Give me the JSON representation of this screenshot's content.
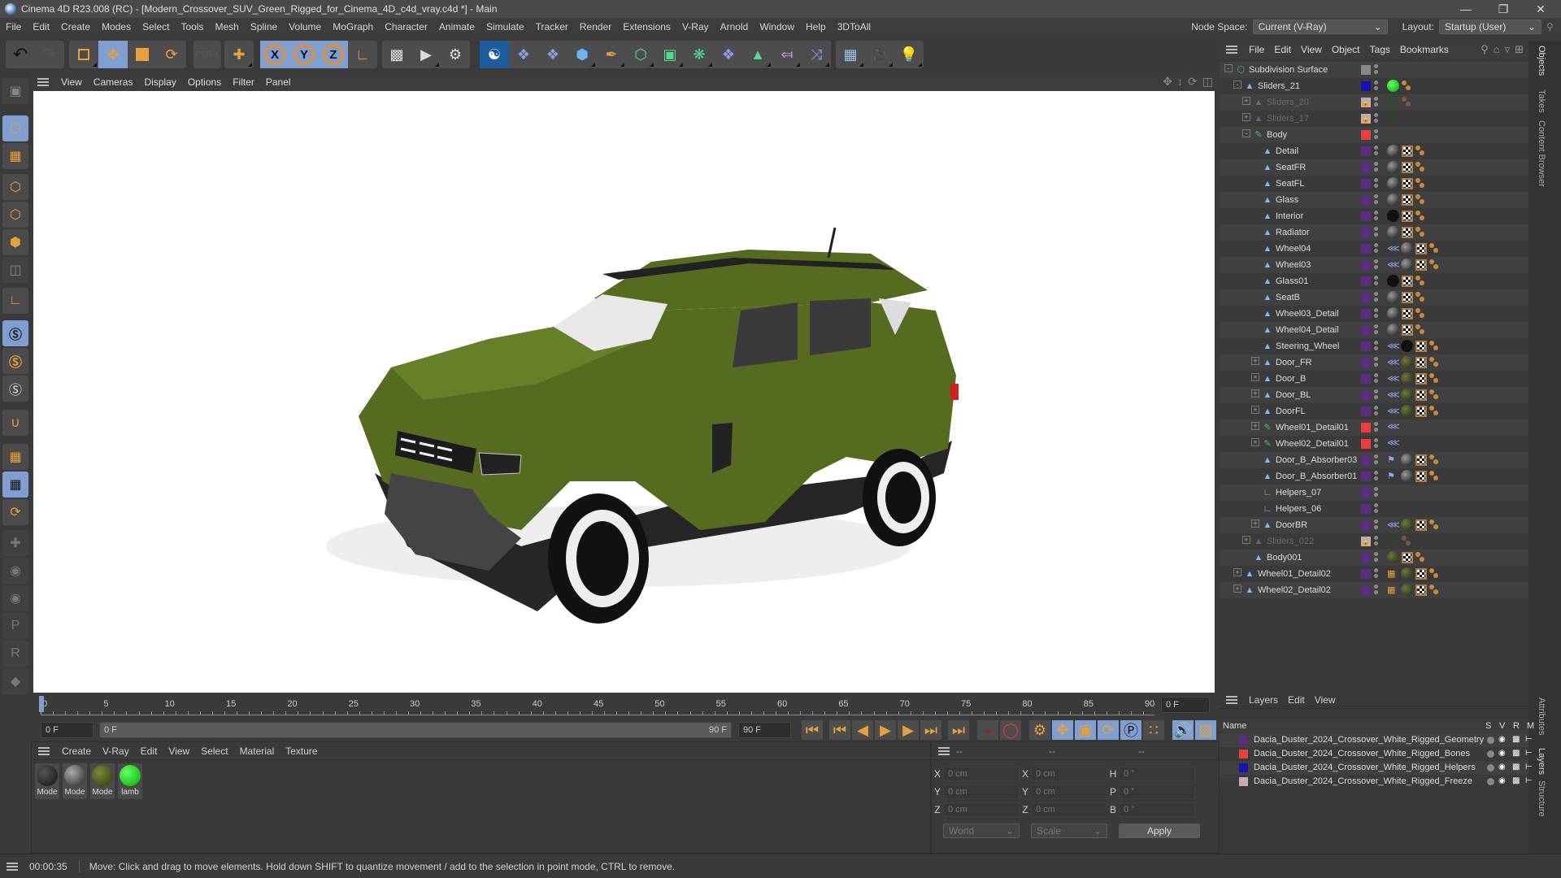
{
  "title": "Cinema 4D R23.008 (RC) - [Modern_Crossover_SUV_Green_Rigged_for_Cinema_4D_c4d_vray.c4d *] - Main",
  "window_controls": [
    "minimize",
    "restore",
    "close"
  ],
  "menu": [
    "File",
    "Edit",
    "Create",
    "Modes",
    "Select",
    "Tools",
    "Mesh",
    "Spline",
    "Volume",
    "MoGraph",
    "Character",
    "Animate",
    "Simulate",
    "Tracker",
    "Render",
    "Extensions",
    "V-Ray",
    "Arnold",
    "Window",
    "Help",
    "3DToAll"
  ],
  "node_space": {
    "label": "Node Space:",
    "value": "Current (V-Ray)"
  },
  "layout": {
    "label": "Layout:",
    "value": "Startup (User)"
  },
  "toolbar": {
    "axis_labels": [
      "X",
      "Y",
      "Z"
    ],
    "tools": [
      "undo",
      "redo",
      "live-selection",
      "move",
      "scale",
      "rotate",
      "psr-reset",
      "add-tool",
      "x-axis",
      "y-axis",
      "z-axis",
      "coordinate-system",
      "render-view",
      "render-picture-viewer",
      "render-settings",
      "vray-logo",
      "python-script-1",
      "python-script-2",
      "cube",
      "pen",
      "subdivision",
      "extrude",
      "boole",
      "python-script-3",
      "mograph-cloner",
      "symmetry",
      "deformer",
      "floor",
      "camera",
      "light"
    ]
  },
  "viewport_menu": [
    "View",
    "Cameras",
    "Display",
    "Options",
    "Filter",
    "Panel"
  ],
  "left_tools": [
    "make-editable",
    "model-mode",
    "texture-mode",
    "point-mode",
    "edge-mode",
    "polygon-mode",
    "uv-mode",
    "axis-mode",
    "snap",
    "snap-settings",
    "workplane-snap",
    "magnet",
    "workplane",
    "locked-workplane",
    "workplane-rotate",
    "joint-tool",
    "bind",
    "weight-tool",
    "pose-p",
    "pose-r",
    "pose-morph"
  ],
  "timeline": {
    "ticks": [
      "0",
      "5",
      "10",
      "15",
      "20",
      "25",
      "30",
      "35",
      "40",
      "45",
      "50",
      "55",
      "60",
      "65",
      "70",
      "75",
      "80",
      "85",
      "90"
    ],
    "current_frame_field": "0 F",
    "start_field": "0 F",
    "range_start": "0 F",
    "range_end": "90 F",
    "end_field": "90 F",
    "frame_readout": "0 F",
    "playhead_frame": 0
  },
  "materials": {
    "menu": [
      "Create",
      "V-Ray",
      "Edit",
      "View",
      "Select",
      "Material",
      "Texture"
    ],
    "items": [
      {
        "label": "Mode",
        "color": "#1a1a1a"
      },
      {
        "label": "Mode",
        "color": "#555"
      },
      {
        "label": "Mode",
        "color": "#4a5a22"
      },
      {
        "label": "lamb",
        "color": "#19c219"
      }
    ]
  },
  "coordinates": {
    "headers": [
      "--",
      "--",
      "--"
    ],
    "rows": [
      {
        "a": "X",
        "av": "0 cm",
        "b": "X",
        "bv": "0 cm",
        "c": "H",
        "cv": "0 °"
      },
      {
        "a": "Y",
        "av": "0 cm",
        "b": "Y",
        "bv": "0 cm",
        "c": "P",
        "cv": "0 °"
      },
      {
        "a": "Z",
        "av": "0 cm",
        "b": "Z",
        "bv": "0 cm",
        "c": "B",
        "cv": "0 °"
      }
    ],
    "space": "World",
    "mode": "Scale",
    "apply": "Apply"
  },
  "objects": {
    "menu": [
      "File",
      "Edit",
      "View",
      "Object",
      "Tags",
      "Bookmarks"
    ],
    "rows": [
      {
        "name": "Subdivision Surface",
        "depth": 0,
        "icon": "subdivision",
        "layer": "#888",
        "exp": "-",
        "tags": []
      },
      {
        "name": "Sliders_21",
        "depth": 1,
        "icon": "null",
        "layer": "#1414b4",
        "exp": "-",
        "tags": [
          "green",
          "phong"
        ]
      },
      {
        "name": "Sliders_20",
        "depth": 2,
        "icon": "null",
        "layer": "lock",
        "exp": "+",
        "dim": true,
        "tags": [
          "dgreen",
          "phong"
        ]
      },
      {
        "name": "Sliders_17",
        "depth": 2,
        "icon": "null",
        "layer": "lock",
        "exp": "+",
        "dim": true,
        "tags": [
          "dgreen"
        ]
      },
      {
        "name": "Body",
        "depth": 2,
        "icon": "bone",
        "layer": "#e84040",
        "exp": "-",
        "tags": []
      },
      {
        "name": "Detail",
        "depth": 3,
        "icon": "null",
        "layer": "#5a2d82",
        "tags": [
          "mat",
          "chk",
          "phong"
        ]
      },
      {
        "name": "SeatFR",
        "depth": 3,
        "icon": "null",
        "layer": "#5a2d82",
        "tags": [
          "mat",
          "chk",
          "phong"
        ]
      },
      {
        "name": "SeatFL",
        "depth": 3,
        "icon": "null",
        "layer": "#5a2d82",
        "tags": [
          "mat",
          "chk",
          "phong"
        ]
      },
      {
        "name": "Glass",
        "depth": 3,
        "icon": "null",
        "layer": "#5a2d82",
        "tags": [
          "mat",
          "chk",
          "phong"
        ]
      },
      {
        "name": "Interior",
        "depth": 3,
        "icon": "null",
        "layer": "#5a2d82",
        "tags": [
          "black",
          "chk",
          "phong"
        ]
      },
      {
        "name": "Radiator",
        "depth": 3,
        "icon": "null",
        "layer": "#5a2d82",
        "tags": [
          "mat",
          "chk",
          "phong"
        ]
      },
      {
        "name": "Wheel04",
        "depth": 3,
        "icon": "null",
        "layer": "#5a2d82",
        "tags": [
          "ik",
          "mat",
          "chk",
          "phong"
        ]
      },
      {
        "name": "Wheel03",
        "depth": 3,
        "icon": "null",
        "layer": "#5a2d82",
        "tags": [
          "ik",
          "mat",
          "chk",
          "phong"
        ]
      },
      {
        "name": "Glass01",
        "depth": 3,
        "icon": "null",
        "layer": "#5a2d82",
        "tags": [
          "black",
          "chk",
          "phong"
        ]
      },
      {
        "name": "SeatB",
        "depth": 3,
        "icon": "null",
        "layer": "#5a2d82",
        "tags": [
          "mat",
          "chk",
          "phong"
        ]
      },
      {
        "name": "Wheel03_Detail",
        "depth": 3,
        "icon": "null",
        "layer": "#5a2d82",
        "tags": [
          "mat",
          "chk",
          "phong"
        ]
      },
      {
        "name": "Wheel04_Detail",
        "depth": 3,
        "icon": "null",
        "layer": "#5a2d82",
        "tags": [
          "mat",
          "chk",
          "phong"
        ]
      },
      {
        "name": "Steering_Wheel",
        "depth": 3,
        "icon": "null",
        "layer": "#5a2d82",
        "tags": [
          "ik",
          "black",
          "chk",
          "phong"
        ]
      },
      {
        "name": "Door_FR",
        "depth": 3,
        "icon": "null",
        "layer": "#5a2d82",
        "exp": "+",
        "tags": [
          "ik",
          "olive",
          "chk",
          "phong"
        ]
      },
      {
        "name": "Door_B",
        "depth": 3,
        "icon": "null",
        "layer": "#5a2d82",
        "exp": "+",
        "tags": [
          "ik",
          "olive",
          "chk",
          "phong"
        ]
      },
      {
        "name": "Door_BL",
        "depth": 3,
        "icon": "null",
        "layer": "#5a2d82",
        "exp": "+",
        "tags": [
          "ik",
          "olive",
          "chk",
          "phong"
        ]
      },
      {
        "name": "DoorFL",
        "depth": 3,
        "icon": "null",
        "layer": "#5a2d82",
        "exp": "+",
        "tags": [
          "ik",
          "olive",
          "chk",
          "phong"
        ]
      },
      {
        "name": "Wheel01_Detail01",
        "depth": 3,
        "icon": "bone",
        "layer": "#e84040",
        "exp": "+",
        "tags": [
          "ik"
        ]
      },
      {
        "name": "Wheel02_Detail01",
        "depth": 3,
        "icon": "bone",
        "layer": "#e84040",
        "exp": "+",
        "tags": [
          "ik"
        ]
      },
      {
        "name": "Door_B_Absorber03",
        "depth": 3,
        "icon": "null",
        "layer": "#5a2d82",
        "tags": [
          "pin",
          "mat",
          "chk",
          "phong"
        ]
      },
      {
        "name": "Door_B_Absorber01",
        "depth": 3,
        "icon": "null",
        "layer": "#5a2d82",
        "tags": [
          "pin",
          "mat",
          "chk",
          "phong"
        ]
      },
      {
        "name": "Helpers_07",
        "depth": 3,
        "icon": "helper",
        "layer": "#5a2d82",
        "tags": []
      },
      {
        "name": "Helpers_06",
        "depth": 3,
        "icon": "helper",
        "layer": "#5a2d82",
        "tags": []
      },
      {
        "name": "DoorBR",
        "depth": 3,
        "icon": "null",
        "layer": "#5a2d82",
        "exp": "+",
        "tags": [
          "ik",
          "olive",
          "chk",
          "phong"
        ]
      },
      {
        "name": "Sliders_022",
        "depth": 2,
        "icon": "null",
        "layer": "lock",
        "exp": "+",
        "dim": true,
        "tags": [
          "dgreen",
          "phong"
        ]
      },
      {
        "name": "Body001",
        "depth": 2,
        "icon": "null",
        "layer": "#5a2d82",
        "tags": [
          "olive",
          "chk",
          "phong"
        ]
      },
      {
        "name": "Wheel01_Detail02",
        "depth": 1,
        "icon": "null",
        "layer": "#5a2d82",
        "exp": "+",
        "tags": [
          "weight",
          "olive",
          "chk",
          "phong"
        ]
      },
      {
        "name": "Wheel02_Detail02",
        "depth": 1,
        "icon": "null",
        "layer": "#5a2d82",
        "exp": "+",
        "tags": [
          "weight",
          "olive",
          "chk",
          "phong"
        ]
      }
    ]
  },
  "side_tabs_top": [
    "Objects",
    "Takes",
    "Content Browser"
  ],
  "side_tabs_bottom": [
    "Attributes",
    "Layers",
    "Structure"
  ],
  "layers": {
    "menu": [
      "Layers",
      "Edit",
      "View"
    ],
    "columns": [
      "Name",
      "S",
      "V",
      "R",
      "M"
    ],
    "items": [
      {
        "name": "Dacia_Duster_2024_Crossover_White_Rigged_Geometry",
        "color": "#5a2d82"
      },
      {
        "name": "Dacia_Duster_2024_Crossover_White_Rigged_Bones",
        "color": "#e84040"
      },
      {
        "name": "Dacia_Duster_2024_Crossover_White_Rigged_Helpers",
        "color": "#1414b4"
      },
      {
        "name": "Dacia_Duster_2024_Crossover_White_Rigged_Freeze",
        "color": "#c8aab8"
      }
    ]
  },
  "status": {
    "time": "00:00:35",
    "message": "Move: Click and drag to move elements. Hold down SHIFT to quantize movement / add to the selection in point mode, CTRL to remove."
  }
}
